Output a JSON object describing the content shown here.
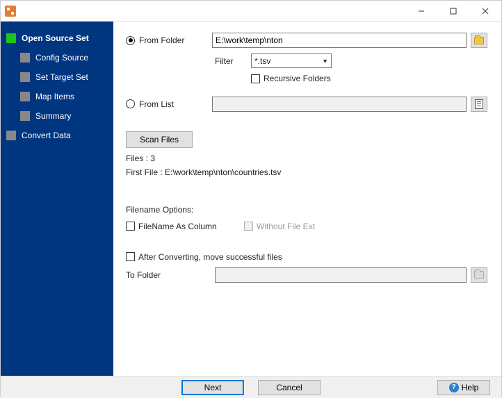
{
  "window": {
    "title": ""
  },
  "sidebar": {
    "items": [
      {
        "label": "Open Source Set"
      },
      {
        "label": "Config Source"
      },
      {
        "label": "Set Target Set"
      },
      {
        "label": "Map Items"
      },
      {
        "label": "Summary"
      },
      {
        "label": "Convert Data"
      }
    ]
  },
  "main": {
    "from_folder_label": "From Folder",
    "folder_path": "E:\\work\\temp\\nton",
    "filter_label": "Filter",
    "filter_value": "*.tsv",
    "recursive_label": "Recursive Folders",
    "from_list_label": "From List",
    "from_list_value": "",
    "scan_files_label": "Scan Files",
    "files_count": "Files : 3",
    "first_file": "First File : E:\\work\\temp\\nton\\countries.tsv",
    "filename_options_label": "Filename Options:",
    "filename_as_column_label": "FileName As Column",
    "without_file_ext_label": "Without File Ext",
    "after_converting_label": "After Converting, move successful files",
    "to_folder_label": "To Folder",
    "to_folder_value": ""
  },
  "footer": {
    "next": "Next",
    "cancel": "Cancel",
    "help": "Help"
  }
}
